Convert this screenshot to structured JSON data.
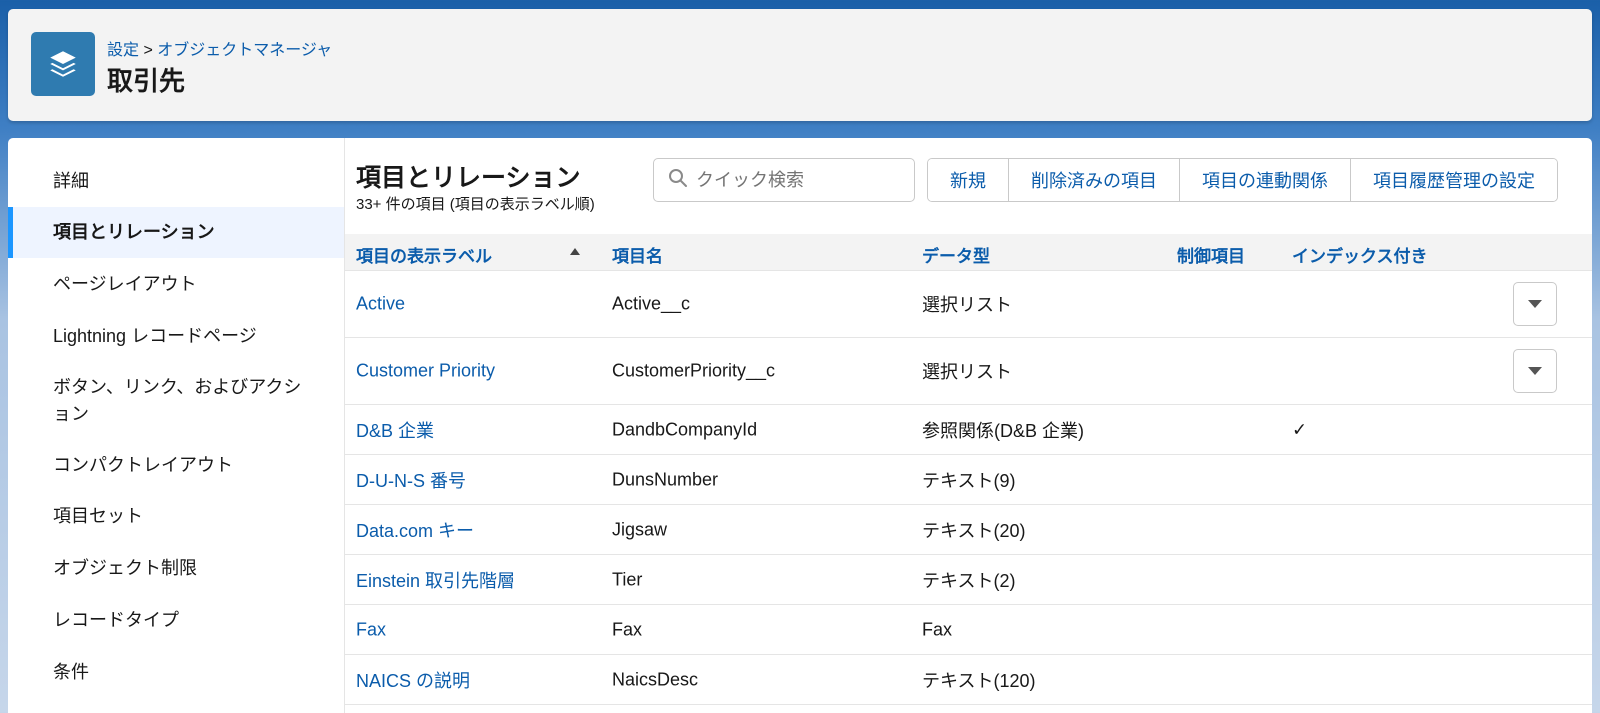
{
  "header": {
    "breadcrumb_root": "設定",
    "breadcrumb_sep": " > ",
    "breadcrumb_current": "オブジェクトマネージャ",
    "title": "取引先",
    "icon": "layers-icon"
  },
  "sidebar": {
    "items": [
      {
        "label": "詳細",
        "name": "sidebar-item-details",
        "active": false
      },
      {
        "label": "項目とリレーション",
        "name": "sidebar-item-fields-relationships",
        "active": true
      },
      {
        "label": "ページレイアウト",
        "name": "sidebar-item-page-layouts",
        "active": false
      },
      {
        "label": "Lightning レコードページ",
        "name": "sidebar-item-lightning-record-pages",
        "active": false
      },
      {
        "label": "ボタン、リンク、およびアクション",
        "name": "sidebar-item-buttons-links-actions",
        "active": false
      },
      {
        "label": "コンパクトレイアウト",
        "name": "sidebar-item-compact-layouts",
        "active": false
      },
      {
        "label": "項目セット",
        "name": "sidebar-item-field-sets",
        "active": false
      },
      {
        "label": "オブジェクト制限",
        "name": "sidebar-item-object-limits",
        "active": false
      },
      {
        "label": "レコードタイプ",
        "name": "sidebar-item-record-types",
        "active": false
      },
      {
        "label": "条件",
        "name": "sidebar-item-conditions",
        "active": false
      }
    ]
  },
  "section": {
    "title": "項目とリレーション",
    "subtitle": "33+ 件の項目 (項目の表示ラベル順)"
  },
  "search": {
    "placeholder": "クイック検索",
    "value": ""
  },
  "toolbar": {
    "new_label": "新規",
    "deleted_fields_label": "削除済みの項目",
    "field_dependencies_label": "項目の連動関係",
    "field_history_label": "項目履歴管理の設定"
  },
  "table": {
    "columns": {
      "label": "項目の表示ラベル",
      "api_name": "項目名",
      "data_type": "データ型",
      "controlling": "制御項目",
      "indexed": "インデックス付き"
    },
    "rows": [
      {
        "label": "Active",
        "api_name": "Active__c",
        "data_type": "選択リスト",
        "controlling": "",
        "indexed": "",
        "has_action": true
      },
      {
        "label": "Customer Priority",
        "api_name": "CustomerPriority__c",
        "data_type": "選択リスト",
        "controlling": "",
        "indexed": "",
        "has_action": true
      },
      {
        "label": "D&B 企業",
        "api_name": "DandbCompanyId",
        "data_type": "参照関係(D&B 企業)",
        "controlling": "",
        "indexed": "✓",
        "has_action": false
      },
      {
        "label": "D-U-N-S 番号",
        "api_name": "DunsNumber",
        "data_type": "テキスト(9)",
        "controlling": "",
        "indexed": "",
        "has_action": false
      },
      {
        "label": "Data.com キー",
        "api_name": "Jigsaw",
        "data_type": "テキスト(20)",
        "controlling": "",
        "indexed": "",
        "has_action": false
      },
      {
        "label": "Einstein 取引先階層",
        "api_name": "Tier",
        "data_type": "テキスト(2)",
        "controlling": "",
        "indexed": "",
        "has_action": false
      },
      {
        "label": "Fax",
        "api_name": "Fax",
        "data_type": "Fax",
        "controlling": "",
        "indexed": "",
        "has_action": false
      },
      {
        "label": "NAICS の説明",
        "api_name": "NaicsDesc",
        "data_type": "テキスト(120)",
        "controlling": "",
        "indexed": "",
        "has_action": false
      }
    ]
  }
}
